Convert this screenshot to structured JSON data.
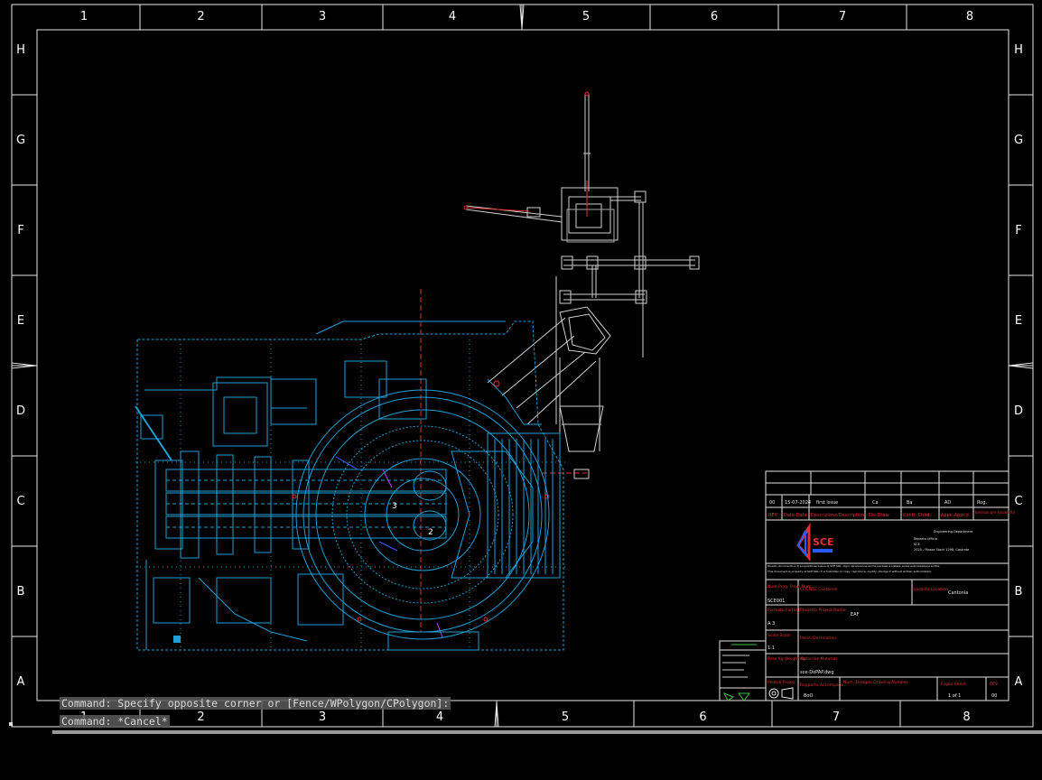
{
  "frame": {
    "columns": [
      "1",
      "2",
      "3",
      "4",
      "5",
      "6",
      "7",
      "8"
    ],
    "rows": [
      "H",
      "G",
      "F",
      "E",
      "D",
      "C",
      "B",
      "A"
    ]
  },
  "callouts": [
    "3",
    "2"
  ],
  "title_block": {
    "revision_row": {
      "rev": "00",
      "date": "15-07-2024",
      "description": "first issue",
      "drawn": "Ca",
      "checked": "Ba",
      "approved": "AD",
      "approved2": "Rog."
    },
    "revision_header": {
      "rev": "REV.",
      "date": "Date-Data",
      "description": "Descrizione/Description",
      "drawn": "Dis-Draw",
      "checked": "Contr.-Chkd",
      "approved": "Appr.-Appr.d",
      "note": "Emesso per Issued for"
    },
    "company_logo": "SCE",
    "company_lines": [
      "Engineering Department",
      "Reparto Ufficio",
      "SCE",
      "2025 - Piazza Stock 1298, Castrate"
    ],
    "disclaimer_lines": [
      "Questo documento è di proprietà esclusiva di SCE SRL. Ogni riproduzione anche parziale è vietata senza autorizzazione scritta.",
      "This document is property of SCE SRL; it is forbidden to copy, reproduce, modify, divulge it without written authorization."
    ],
    "num_prog_label": "Num.Prog. Prog. Num",
    "num_prog_value": "SCE001",
    "client_label": "CLIENTE Customer",
    "location_label": "Località Location",
    "location_value": "Cantonia",
    "format_label": "Formato Format",
    "format_value": "A 3",
    "project_label": "Progetto Project Name",
    "project_value": "EAF",
    "scale_label": "Scala Scale",
    "scale_value": "1:1",
    "field_label": "Posiz. Destination",
    "weight_label": "Peso Kg Weight Kg",
    "material_label": "Materiale Material",
    "file_value": "sce-DoPAP.dwg",
    "drawing_view_label": "Metodi Proiez.",
    "revised_label": "Rapporto Accompagn.",
    "revised_value": "BoO",
    "drawing_number_label": "Num. Disegno Drawing Number",
    "sheet_label": "Foglio Sheet",
    "sheet_value": "1 of 1",
    "rev_label": "REV.",
    "rev_value": "00"
  },
  "command_line": {
    "line1": "Command: Specify opposite corner or [Fence/WPolygon/CPolygon]:",
    "line2": "Command: *Cancel*"
  },
  "colors": {
    "background": "#000000",
    "frame": "#ffffff",
    "layer_cyan": "#1e9fd6",
    "layer_white": "#d8d8d8",
    "layer_red": "#e03030",
    "layer_magenta": "#c040ff"
  }
}
